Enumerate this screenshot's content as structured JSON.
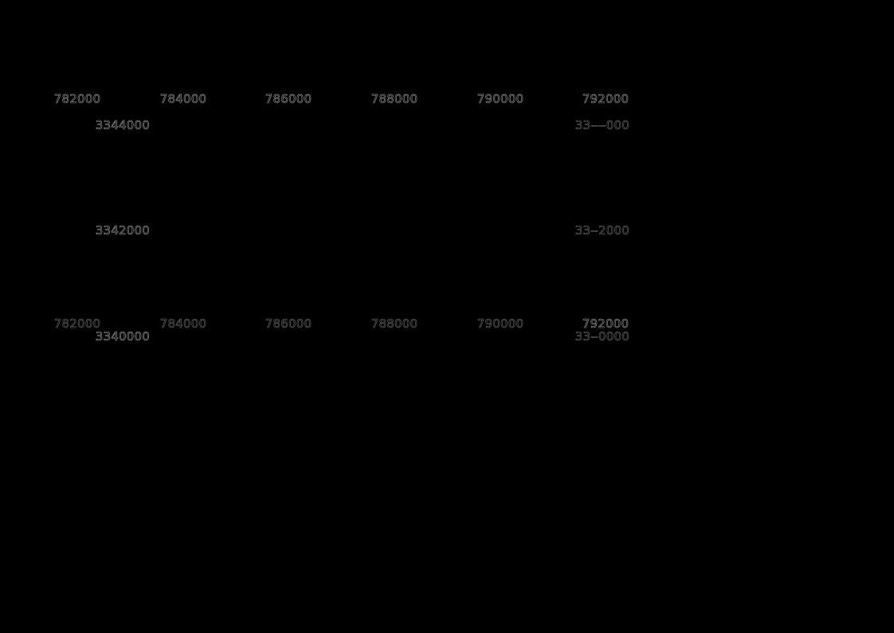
{
  "map": {
    "background": "#000000",
    "label_color": "#9a9a9a",
    "label_color_dim": "#6a6a6a",
    "grid": false,
    "easting_ticks": [
      "782000",
      "784000",
      "786000",
      "788000",
      "790000",
      "792000"
    ],
    "northing_ticks": [
      "3344000",
      "3342000",
      "3340000"
    ],
    "northing_ticks_right": [
      "33‒‒000",
      "33‒2000",
      "33‒0000"
    ],
    "easting_range": [
      782000,
      792000
    ],
    "northing_range": [
      3340000,
      3344000
    ]
  }
}
